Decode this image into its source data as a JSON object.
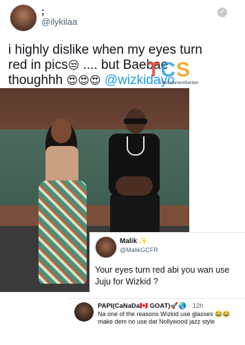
{
  "original_tweet": {
    "display_name": ";",
    "handle": "@ilykilaa",
    "text_lines": [
      [
        "i highly dislike when my eyes turn"
      ],
      [
        "red in pics",
        "😒",
        " .... but Baebae"
      ],
      [
        "thoughhh ",
        "😍😍😍",
        " ",
        "@wizkidayo"
      ]
    ],
    "line1": "i highly dislike when my eyes turn",
    "line2_a": "red in pics",
    "line2_emoji": "😒",
    "line2_b": " .... but Baebae",
    "line3_a": "thoughhh ",
    "line3_emoji": "😍😍😍",
    "line3_mention": "@wizkidayo"
  },
  "watermark": {
    "t": "T",
    "c": "C",
    "s": "S",
    "sub": "TheCommentSection"
  },
  "reply1": {
    "display_name": "Malik",
    "name_emoji": "✨",
    "handle": "@MalikGCFR",
    "text": "Your eyes turn red abi you wan use Juju for Wizkid ?"
  },
  "reply2": {
    "display_name": "PAPI(CaNaDa🇨🇦 GOAT)🚀🌏",
    "time": " · 12h",
    "text": "Na one of the reasons Wizkid use glasses 😂😂make dem no use dat Nollywood jazz style"
  },
  "colors": {
    "mention": "#1d9bf0",
    "handle_gray": "#536471"
  }
}
